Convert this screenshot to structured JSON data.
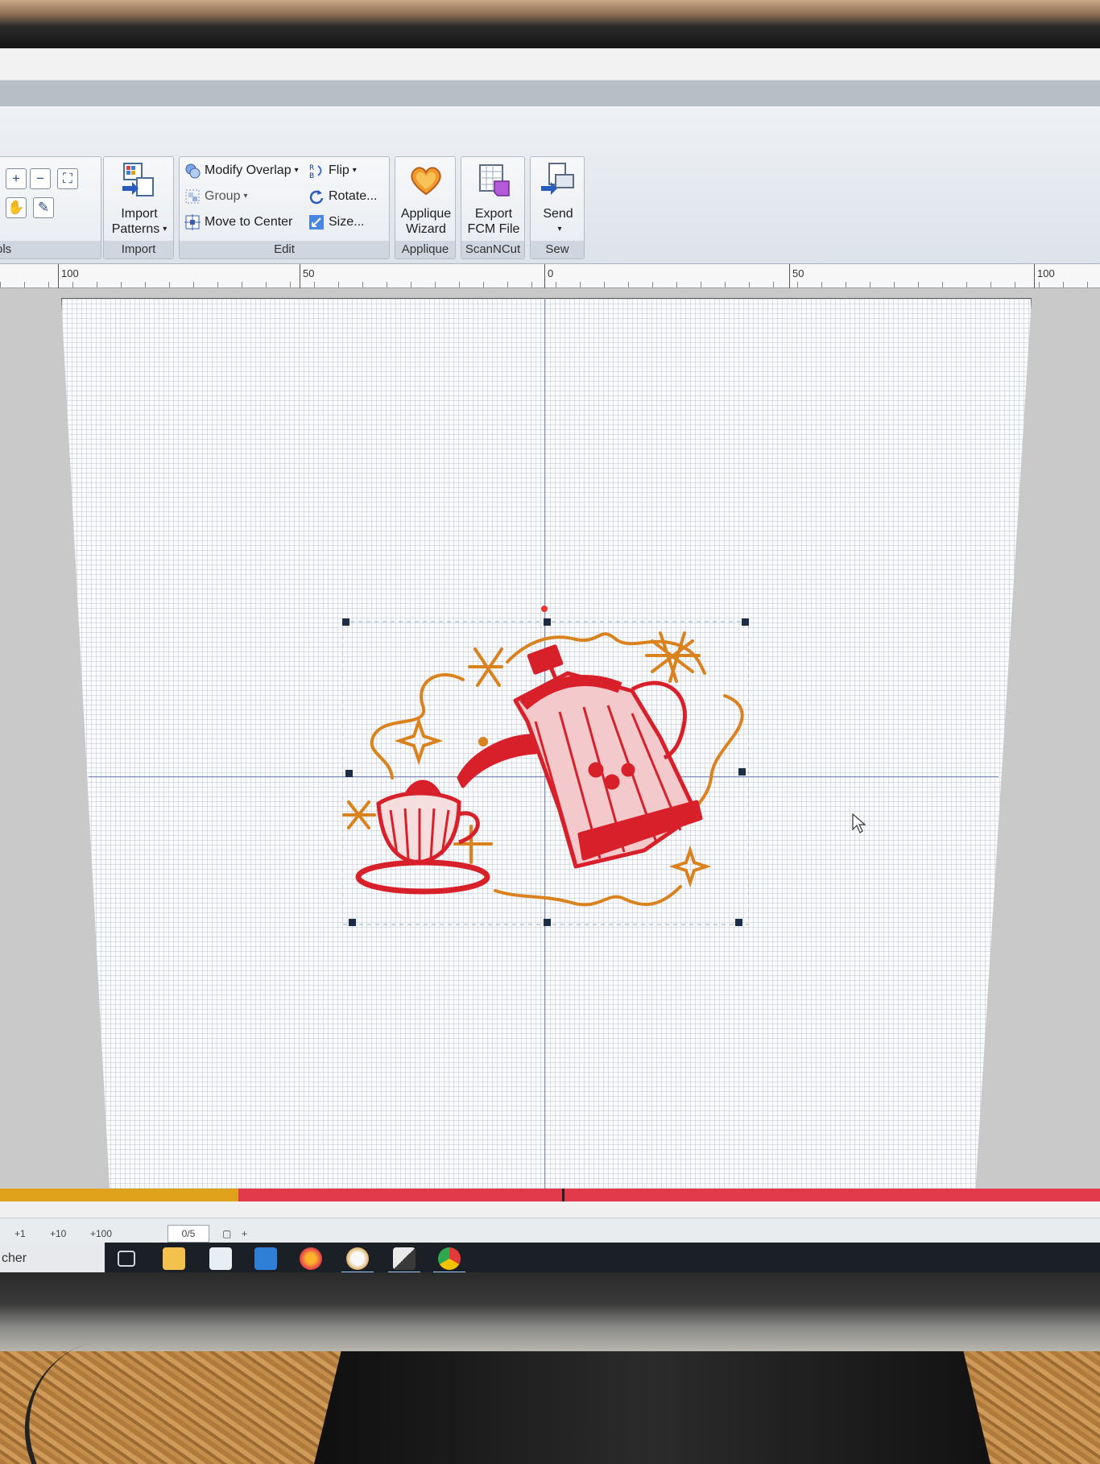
{
  "ribbon": {
    "tools_group": {
      "label": "ols"
    },
    "import_group": {
      "label": "Import",
      "import_patterns": {
        "line1": "Import",
        "line2": "Patterns"
      }
    },
    "edit_group": {
      "label": "Edit",
      "modify_overlap": "Modify Overlap",
      "group": "Group",
      "move_to_center": "Move to Center",
      "flip": "Flip",
      "rotate": "Rotate...",
      "size": "Size..."
    },
    "applique_group": {
      "label": "Applique",
      "applique_wizard": {
        "line1": "Applique",
        "line2": "Wizard"
      }
    },
    "scanncut_group": {
      "label": "ScanNCut",
      "export_fcm": {
        "line1": "Export",
        "line2": "FCM File"
      }
    },
    "sew_group": {
      "label": "Sew",
      "send": "Send"
    }
  },
  "ruler": {
    "labels": [
      "100",
      "50",
      "0",
      "50",
      "100"
    ]
  },
  "statusbar": {
    "step1": "+1",
    "step10": "+10",
    "step100": "+100",
    "page_current": "0",
    "page_total": "/5",
    "zoom_plus": "+"
  },
  "taskbar": {
    "search_text": "cher"
  },
  "colors": {
    "thread_red": "#d8202a",
    "thread_orange": "#d9821e",
    "color_bar_gold": "#e0a21a",
    "color_bar_red": "#e23a4a"
  }
}
